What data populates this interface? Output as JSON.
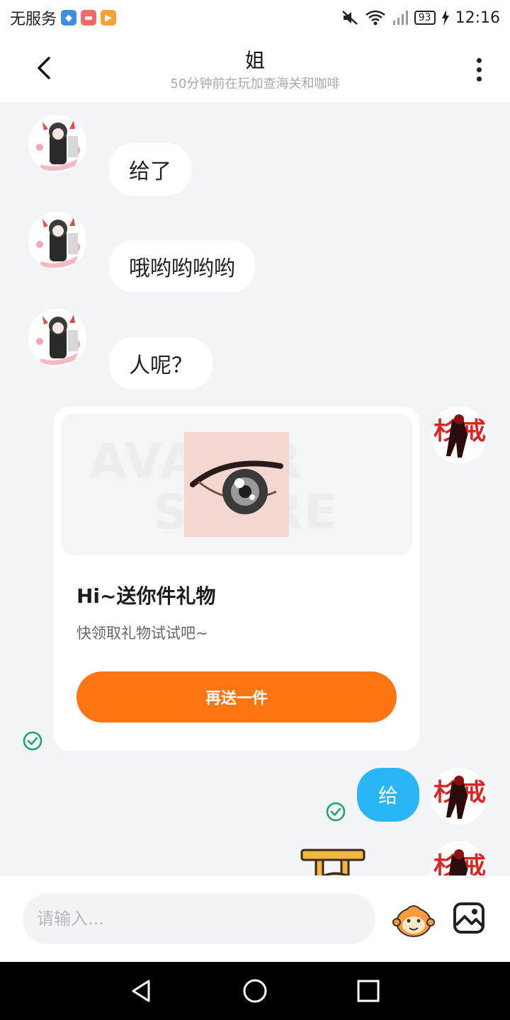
{
  "status_bar": {
    "carrier": "无服务",
    "battery": "93",
    "time": "12:16",
    "icons": [
      "shield-app-icon",
      "shop-app-icon",
      "video-app-icon",
      "mute-icon",
      "wifi-icon",
      "signal-icon",
      "charging-icon"
    ]
  },
  "header": {
    "title": "姐",
    "subtitle": "50分钟前在玩加查海关和咖啡"
  },
  "messages": [
    {
      "side": "left",
      "text": "给了"
    },
    {
      "side": "left",
      "text": "哦哟哟哟哟"
    },
    {
      "side": "left",
      "text": "人呢？"
    }
  ],
  "gift_card": {
    "watermark_line1": "AVATAR",
    "watermark_line2": "STORE",
    "title": "Hi~送你件礼物",
    "description": "快领取礼物试试吧~",
    "button_label": "再送一件"
  },
  "outgoing": {
    "text": "给"
  },
  "input": {
    "placeholder": "请输入..."
  },
  "colors": {
    "accent_blue": "#2ab5f6",
    "gift_orange": "#ff7512",
    "sent_check": "#1aa36a",
    "background": "#f2f4f8"
  }
}
